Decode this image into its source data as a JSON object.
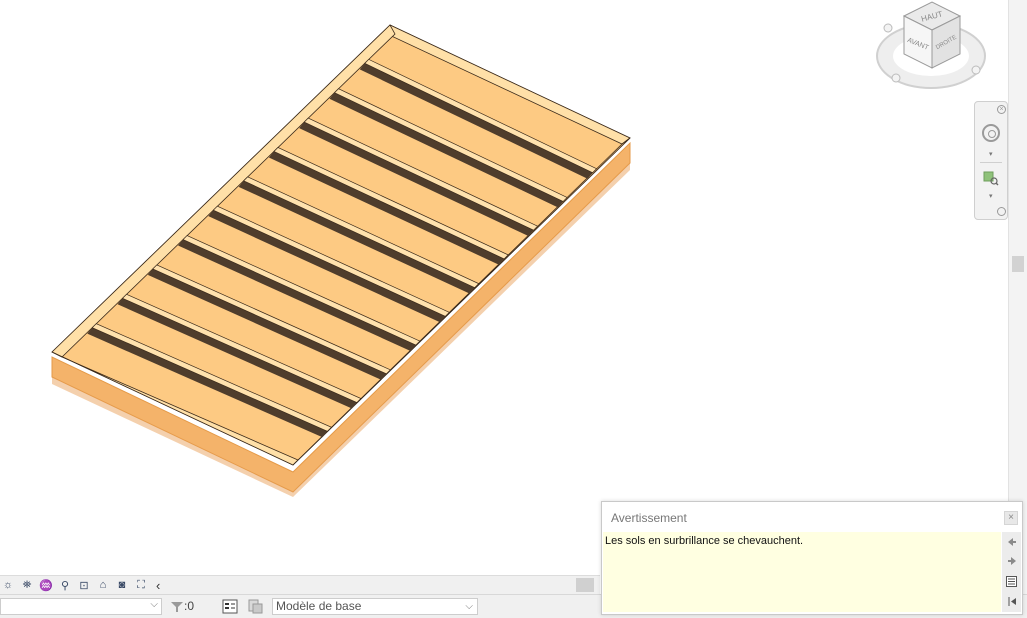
{
  "viewcube": {
    "face_top": "HAUT",
    "face_front": "AVANT",
    "face_right": "DROITE"
  },
  "statusbar": {
    "filter_count": ":0",
    "model_label": "Modèle de base",
    "dropdown_glyph": "⌵"
  },
  "view_toolbar": {
    "collapse_glyph": "‹"
  },
  "warning": {
    "title": "Avertissement",
    "close_glyph": "×",
    "message": "Les sols en surbrillance se chevauchent."
  },
  "navbar": {
    "close_glyph": "×",
    "expand_glyph": "▾"
  },
  "colors": {
    "joist_light": "#fccd82",
    "joist_shadow": "#4f3d2c",
    "plank_face": "#ffe2ae",
    "base_edge": "#f5ad5c",
    "warning_body": "#ffffe1"
  }
}
